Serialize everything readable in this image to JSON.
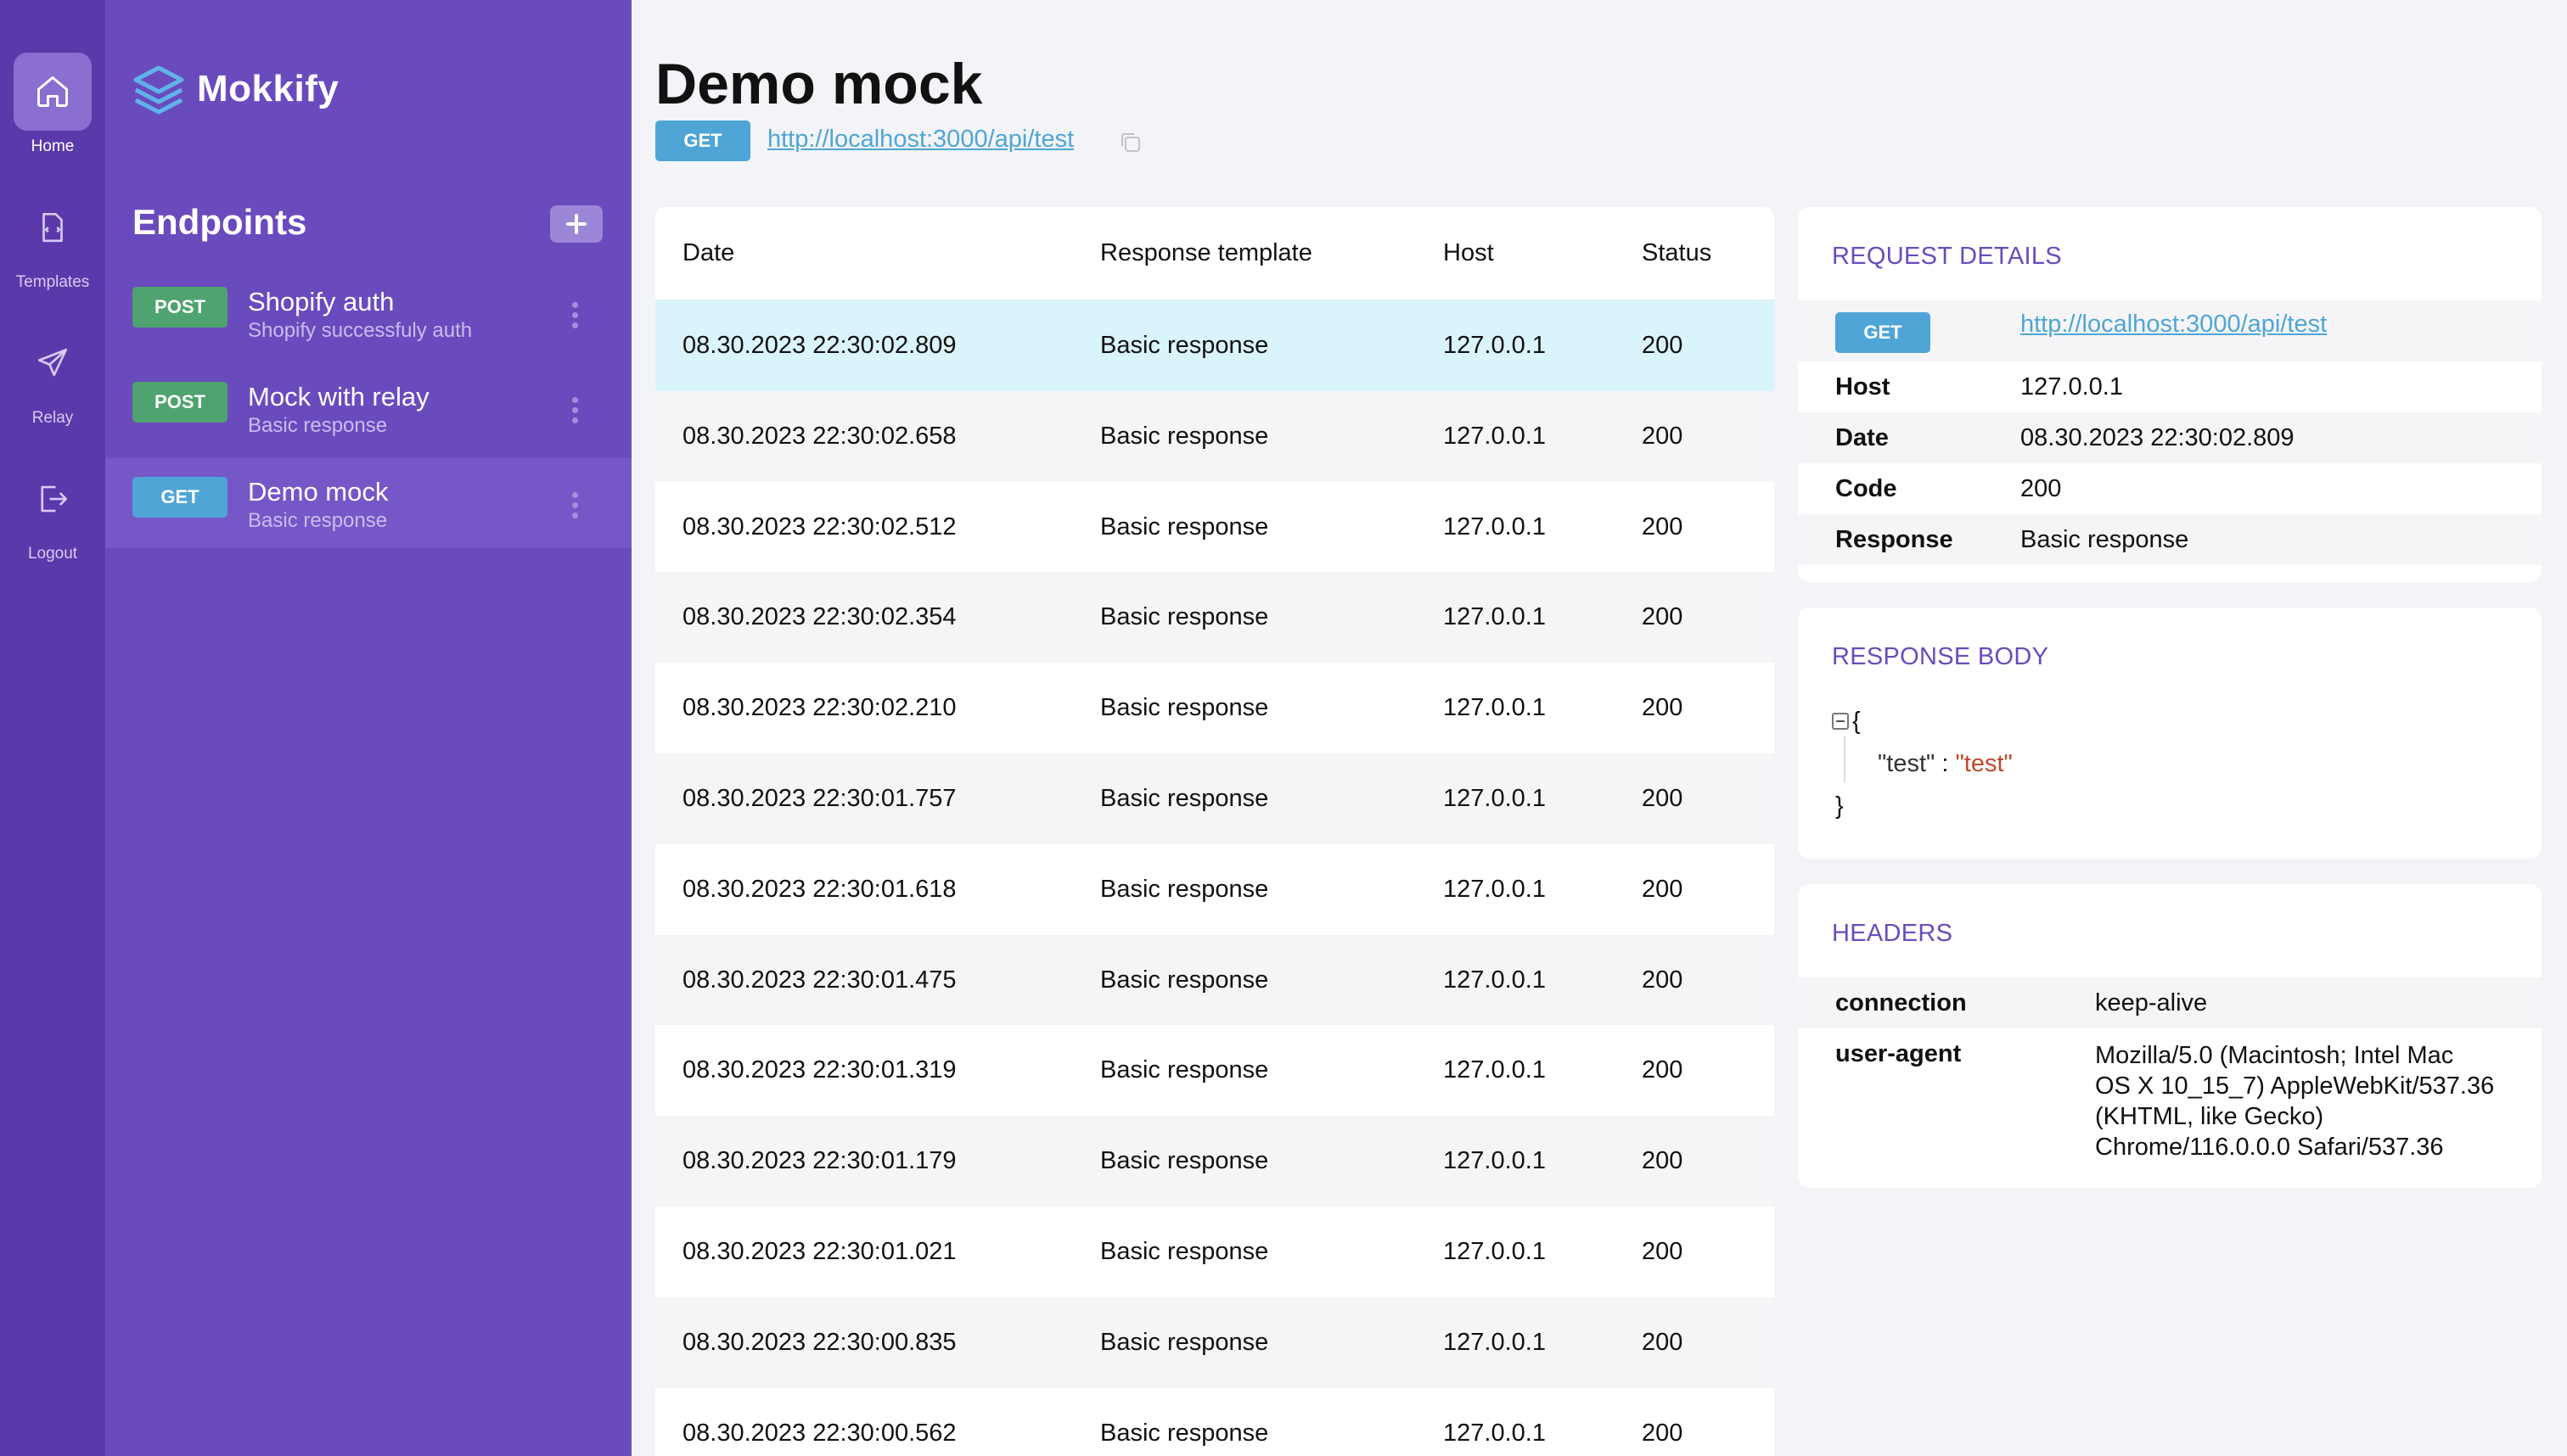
{
  "rail": {
    "items": [
      {
        "label": "Home",
        "icon": "home-icon",
        "active": true
      },
      {
        "label": "Templates",
        "icon": "templates-icon",
        "active": false
      },
      {
        "label": "Relay",
        "icon": "send-icon",
        "active": false
      },
      {
        "label": "Logout",
        "icon": "logout-icon",
        "active": false
      }
    ]
  },
  "sidebar": {
    "logo_text": "Mokkify",
    "section_title": "Endpoints",
    "endpoints": [
      {
        "method": "POST",
        "name": "Shopify auth",
        "subtitle": "Shopify successfuly auth"
      },
      {
        "method": "POST",
        "name": "Mock with relay",
        "subtitle": "Basic response"
      },
      {
        "method": "GET",
        "name": "Demo mock",
        "subtitle": "Basic response",
        "active": true
      }
    ]
  },
  "main": {
    "title": "Demo mock",
    "method": "GET",
    "url": "http://localhost:3000/api/test"
  },
  "table": {
    "headers": [
      "Date",
      "Response template",
      "Host",
      "Status"
    ],
    "rows": [
      {
        "date": "08.30.2023 22:30:02.809",
        "template": "Basic response",
        "host": "127.0.0.1",
        "status": "200"
      },
      {
        "date": "08.30.2023 22:30:02.658",
        "template": "Basic response",
        "host": "127.0.0.1",
        "status": "200"
      },
      {
        "date": "08.30.2023 22:30:02.512",
        "template": "Basic response",
        "host": "127.0.0.1",
        "status": "200"
      },
      {
        "date": "08.30.2023 22:30:02.354",
        "template": "Basic response",
        "host": "127.0.0.1",
        "status": "200"
      },
      {
        "date": "08.30.2023 22:30:02.210",
        "template": "Basic response",
        "host": "127.0.0.1",
        "status": "200"
      },
      {
        "date": "08.30.2023 22:30:01.757",
        "template": "Basic response",
        "host": "127.0.0.1",
        "status": "200"
      },
      {
        "date": "08.30.2023 22:30:01.618",
        "template": "Basic response",
        "host": "127.0.0.1",
        "status": "200"
      },
      {
        "date": "08.30.2023 22:30:01.475",
        "template": "Basic response",
        "host": "127.0.0.1",
        "status": "200"
      },
      {
        "date": "08.30.2023 22:30:01.319",
        "template": "Basic response",
        "host": "127.0.0.1",
        "status": "200"
      },
      {
        "date": "08.30.2023 22:30:01.179",
        "template": "Basic response",
        "host": "127.0.0.1",
        "status": "200"
      },
      {
        "date": "08.30.2023 22:30:01.021",
        "template": "Basic response",
        "host": "127.0.0.1",
        "status": "200"
      },
      {
        "date": "08.30.2023 22:30:00.835",
        "template": "Basic response",
        "host": "127.0.0.1",
        "status": "200"
      },
      {
        "date": "08.30.2023 22:30:00.562",
        "template": "Basic response",
        "host": "127.0.0.1",
        "status": "200"
      }
    ]
  },
  "request_details": {
    "title": "REQUEST DETAILS",
    "method": "GET",
    "url": "http://localhost:3000/api/test",
    "host_label": "Host",
    "host": "127.0.0.1",
    "date_label": "Date",
    "date": "08.30.2023 22:30:02.809",
    "code_label": "Code",
    "code": "200",
    "response_label": "Response",
    "response": "Basic response"
  },
  "response_body": {
    "title": "RESPONSE BODY",
    "open_brace": "{",
    "key": "\"test\"",
    "sep": " : ",
    "value": "\"test\"",
    "close_brace": "}"
  },
  "headers": {
    "title": "HEADERS",
    "items": [
      {
        "key": "connection",
        "value": "keep-alive"
      },
      {
        "key": "user-agent",
        "value_lines": [
          "Mozilla/5.0 (Macintosh; Intel Mac",
          "OS X 10_15_7) AppleWebKit/537.36",
          "(KHTML, like Gecko)",
          "Chrome/116.0.0.0 Safari/537.36"
        ]
      }
    ]
  },
  "colors": {
    "rail": "#5a3aab",
    "sidebar": "#6a4bbd",
    "post": "#4fa36f",
    "get": "#4fa5d6",
    "selected_row": "#d9f4fa",
    "accent": "#6a4bbd"
  }
}
